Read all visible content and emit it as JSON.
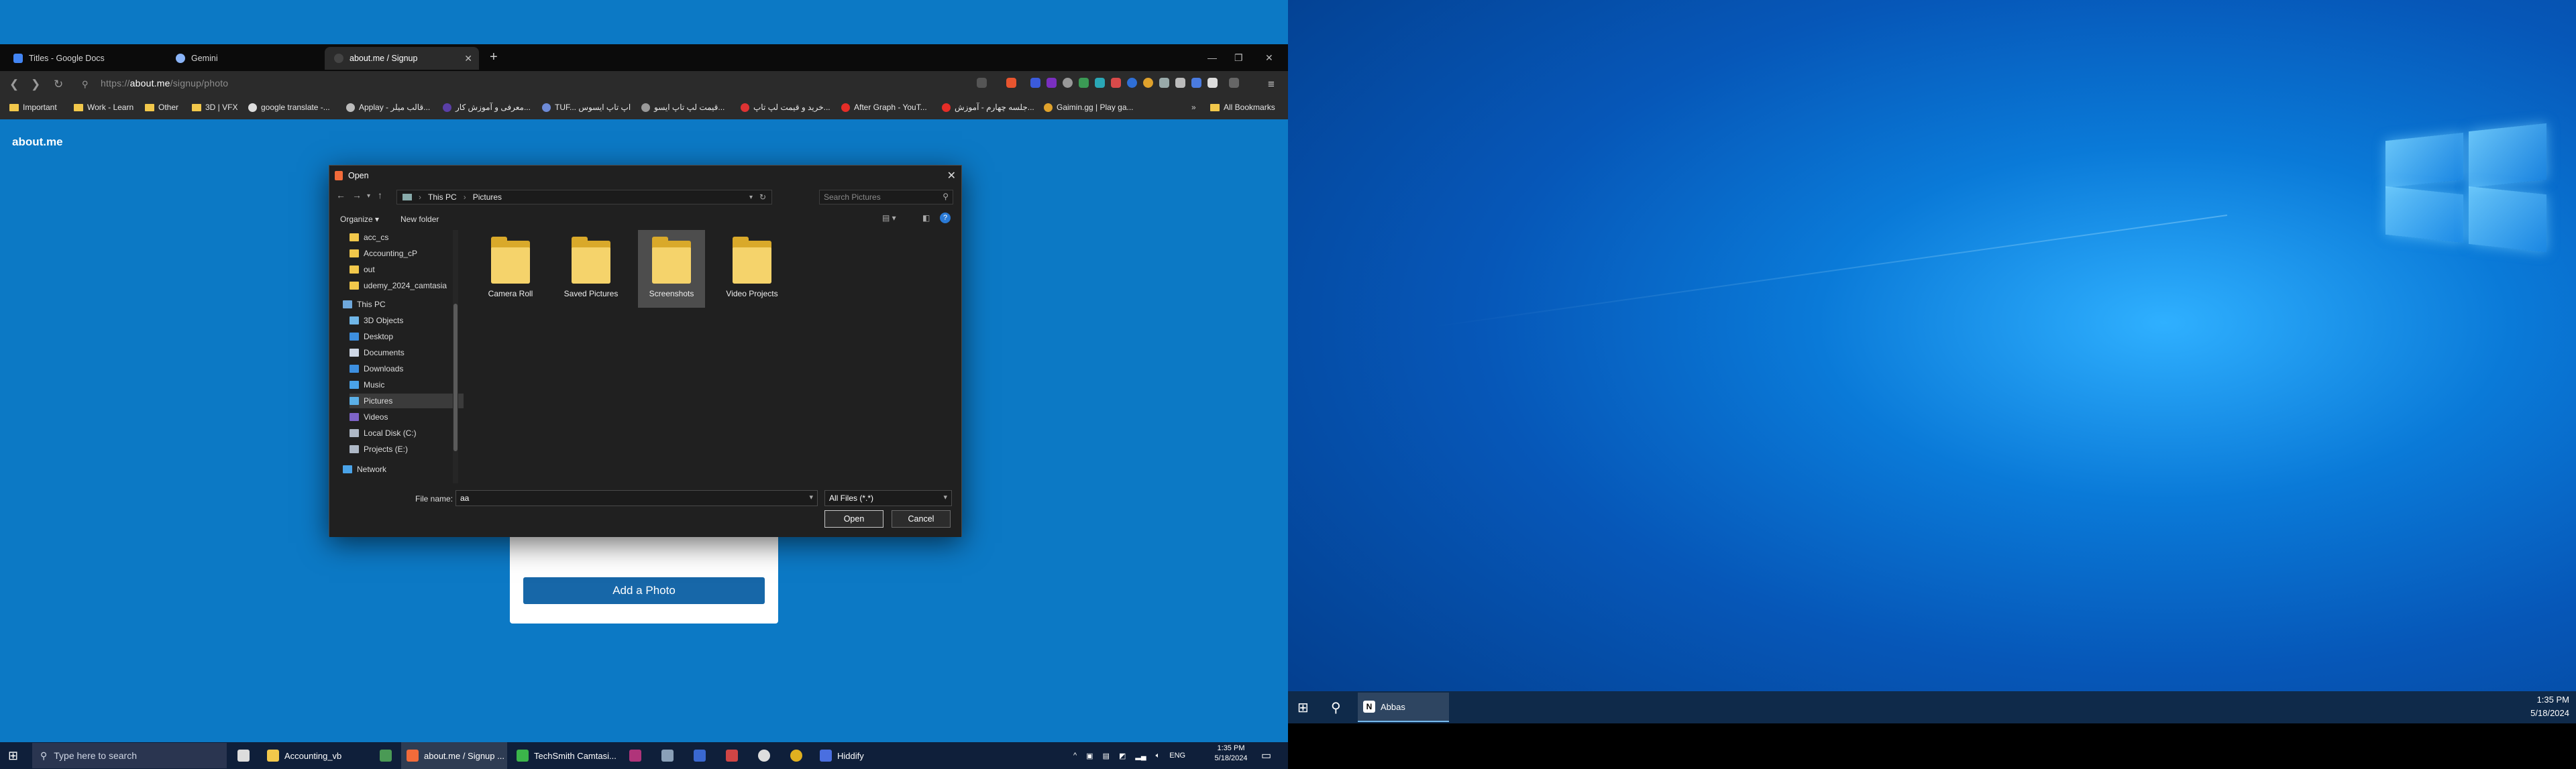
{
  "browser": {
    "tabs": [
      {
        "label": "Titles - Google Docs",
        "active": false
      },
      {
        "label": "Gemini",
        "active": false
      },
      {
        "label": "about.me / Signup",
        "active": true
      }
    ],
    "url_prefix": "https://",
    "url_domain": "about.me",
    "url_path": "/signup/photo",
    "bookmarks": [
      "Important",
      "Work - Learn",
      "Other",
      "3D | VFX",
      "google translate -...",
      "Applay - قالب میلر...",
      "معرفی و آموزش کار...",
      "TUF... اپ تاپ ایسوس",
      "قیمت لپ تاپ ایسو...",
      "خرید و قیمت لپ تاپ...",
      "After Graph - YouT...",
      "جلسه چهارم - آموزش...",
      "Gaimin.gg | Play ga..."
    ],
    "all_bookmarks": "All Bookmarks"
  },
  "page": {
    "brand": "about.me",
    "add_photo": "Add a Photo"
  },
  "dialog": {
    "title": "Open",
    "path": [
      "This PC",
      "Pictures"
    ],
    "search_placeholder": "Search Pictures",
    "organize": "Organize ▾",
    "new_folder": "New folder",
    "tree": [
      "acc_cs",
      "Accounting_cP",
      "out",
      "udemy_2024_camtasia",
      "This PC",
      "3D Objects",
      "Desktop",
      "Documents",
      "Downloads",
      "Music",
      "Pictures",
      "Videos",
      "Local Disk (C:)",
      "Projects (E:)",
      "Network"
    ],
    "folders": [
      "Camera Roll",
      "Saved Pictures",
      "Screenshots",
      "Video Projects"
    ],
    "file_name_label": "File name:",
    "file_name_value": "aa",
    "file_type": "All Files (*.*)",
    "open": "Open",
    "cancel": "Cancel"
  },
  "taskbar": {
    "search_placeholder": "Type here to search",
    "items": [
      "Accounting_vb",
      "about.me / Signup ...",
      "TechSmith Camtasi...",
      "Hiddify"
    ],
    "lang": "ENG",
    "time": "1:35 PM",
    "date": "5/18/2024"
  },
  "desktop": {
    "app": "Abbas",
    "time": "1:35 PM",
    "date": "5/18/2024"
  },
  "colors": {
    "page_bg": "#0c79c5",
    "button": "#1767a8",
    "dialog_bg": "#202020"
  }
}
